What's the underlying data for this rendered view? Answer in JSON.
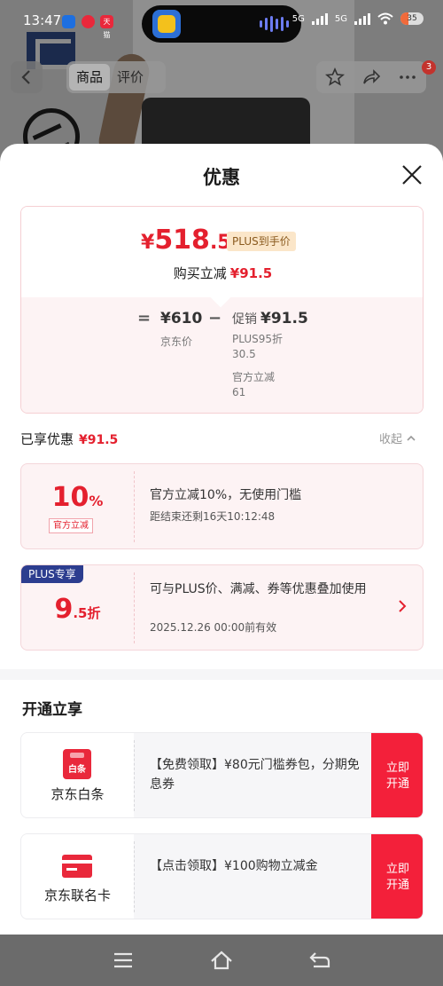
{
  "status_bar": {
    "time": "13:47",
    "apps": [
      {
        "name": "app-icon-1",
        "color": "#1d6fe0",
        "text": ""
      },
      {
        "name": "app-icon-2",
        "color": "#e9283b",
        "text": ""
      },
      {
        "name": "app-icon-3",
        "color": "#e9283b",
        "text": "天猫"
      }
    ],
    "network": [
      "5G",
      "5G"
    ],
    "battery": "35"
  },
  "product_nav": {
    "tabs": [
      "商品",
      "评价"
    ],
    "active_tab": 0,
    "badge_count": "3"
  },
  "sheet": {
    "title": "优惠"
  },
  "price_card": {
    "final_yen": "¥",
    "final_int": "518",
    "final_dec": ".5",
    "plus_tag": "PLUS到手价",
    "reduce_label": "购买立减",
    "reduce_value": "¥91.5",
    "equals": "=",
    "minus": "−",
    "orig_price": "¥610",
    "orig_label": "京东价",
    "promo_label": "促销",
    "promo_value": "¥91.5",
    "promo_items": [
      {
        "label": "PLUS95折",
        "value": "30.5"
      },
      {
        "label": "官方立减",
        "value": "61"
      }
    ]
  },
  "enjoyed": {
    "label": "已享优惠",
    "value": "¥91.5",
    "collapse": "收起"
  },
  "coupons": [
    {
      "big_num": "10",
      "big_unit": "%",
      "tag": "官方立减",
      "text": "官方立减10%，无使用门槛",
      "sub": "距结束还剩16天10:12:48"
    },
    {
      "ribbon": "PLUS专享",
      "big_num": "9",
      "big_unit": ".5折",
      "text": "可与PLUS价、满减、券等优惠叠加使用",
      "sub": "2025.12.26 00:00前有效"
    }
  ],
  "open_section": {
    "title": "开通立享",
    "offers": [
      {
        "icon_text": "白条",
        "name": "京东白条",
        "text": "【免费领取】¥80元门槛券包，分期免息券",
        "cta": "立即开通"
      },
      {
        "name": "京东联名卡",
        "text": "【点击领取】¥100购物立减金",
        "cta": "立即开通"
      }
    ]
  },
  "colors": {
    "accent_red": "#e4202e",
    "plus_blue": "#2c3d8f",
    "cta_red": "#f3203a"
  }
}
